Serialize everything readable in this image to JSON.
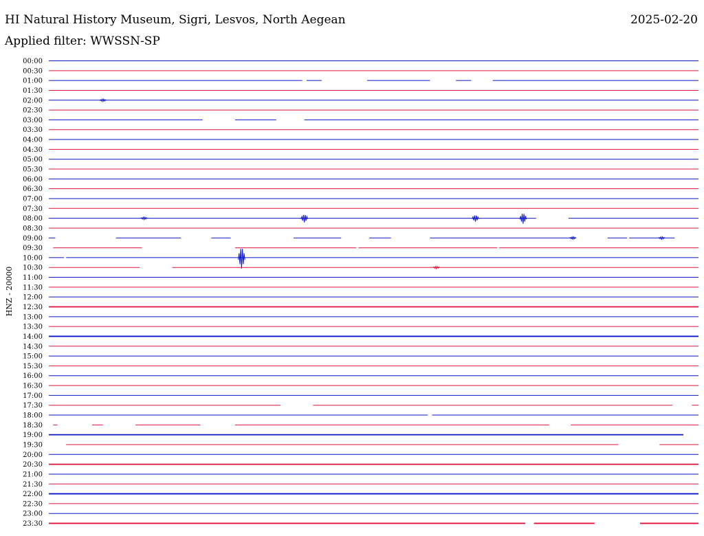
{
  "header": {
    "station": "HI Natural History Museum, Sigri, Lesvos, North Aegean",
    "date": "2025-02-20",
    "filter": "Applied filter: WWSSN-SP"
  },
  "colors": {
    "even_row": "#0a14c8",
    "odd_row": "#e0103a",
    "label": "#000000"
  },
  "chart_data": {
    "type": "line",
    "title": "",
    "ylabel": "HNZ - 20000",
    "xlabel": "",
    "grid": false,
    "row_labels": [
      "00:00",
      "00:30",
      "01:00",
      "01:30",
      "02:00",
      "02:30",
      "03:00",
      "03:30",
      "04:00",
      "04:30",
      "05:00",
      "05:30",
      "06:00",
      "06:30",
      "07:00",
      "07:30",
      "08:00",
      "08:30",
      "09:00",
      "09:30",
      "10:00",
      "10:30",
      "11:00",
      "11:30",
      "12:00",
      "12:30",
      "13:00",
      "13:30",
      "14:00",
      "14:30",
      "15:00",
      "15:30",
      "16:00",
      "16:30",
      "17:00",
      "17:30",
      "18:00",
      "18:30",
      "19:00",
      "19:30",
      "20:00",
      "20:30",
      "21:00",
      "21:30",
      "22:00",
      "22:30",
      "23:00",
      "23:30"
    ],
    "x_range_minutes": [
      0,
      30
    ],
    "rows": [
      {
        "row": 2,
        "segments": [
          [
            0,
            11.7
          ],
          [
            11.9,
            12.6
          ],
          [
            14.7,
            17.6
          ],
          [
            18.8,
            19.5
          ],
          [
            20.5,
            30
          ]
        ]
      },
      {
        "row": 4,
        "segments": [
          [
            0,
            30
          ]
        ],
        "events": [
          [
            2.5,
            0.2
          ]
        ]
      },
      {
        "row": 6,
        "segments": [
          [
            0,
            7.1
          ],
          [
            8.6,
            10.5
          ],
          [
            11.8,
            30
          ]
        ]
      },
      {
        "row": 16,
        "segments": [
          [
            0,
            22.5
          ],
          [
            24,
            30
          ]
        ],
        "events": [
          [
            4.4,
            0.2
          ],
          [
            11.8,
            0.6
          ],
          [
            19.7,
            0.5
          ],
          [
            21.9,
            0.8
          ]
        ]
      },
      {
        "row": 18,
        "segments": [
          [
            0,
            0.3
          ],
          [
            3.1,
            6.1
          ],
          [
            7.5,
            8.4
          ],
          [
            11.3,
            13.5
          ],
          [
            14.8,
            15.8
          ],
          [
            17.6,
            24.3
          ],
          [
            25.8,
            26.7
          ],
          [
            26.8,
            28.9
          ]
        ],
        "events": [
          [
            24.2,
            0.2
          ],
          [
            28.3,
            0.2
          ]
        ]
      },
      {
        "row": 19,
        "segments": [
          [
            0.2,
            4.3
          ],
          [
            8.6,
            14.2
          ],
          [
            14.3,
            20.7
          ],
          [
            20.8,
            30
          ]
        ]
      },
      {
        "row": 20,
        "segments": [
          [
            0,
            0.7
          ],
          [
            0.8,
            30
          ]
        ],
        "events": [
          [
            8.9,
            1.6
          ]
        ]
      },
      {
        "row": 21,
        "segments": [
          [
            0,
            4.2
          ],
          [
            5.7,
            30
          ]
        ],
        "events": [
          [
            17.9,
            0.2
          ]
        ]
      },
      {
        "row": 35,
        "segments": [
          [
            0,
            10.7
          ],
          [
            12.2,
            28.8
          ],
          [
            29.7,
            30
          ]
        ]
      },
      {
        "row": 36,
        "segments": [
          [
            0,
            17.5
          ],
          [
            17.7,
            30
          ]
        ]
      },
      {
        "row": 37,
        "segments": [
          [
            0.2,
            0.4
          ],
          [
            2,
            2.5
          ],
          [
            4,
            7
          ],
          [
            8.6,
            23.1
          ],
          [
            24.1,
            30
          ]
        ]
      },
      {
        "row": 38,
        "segments": [
          [
            0,
            29.3
          ]
        ]
      },
      {
        "row": 39,
        "segments": [
          [
            0.8,
            26.3
          ],
          [
            28.2,
            30
          ]
        ]
      },
      {
        "row": 47,
        "segments": [
          [
            0,
            22
          ],
          [
            22.4,
            25.2
          ],
          [
            27.3,
            30
          ]
        ]
      }
    ],
    "noisy_rows": [
      25,
      28,
      38,
      41,
      44,
      47
    ]
  }
}
